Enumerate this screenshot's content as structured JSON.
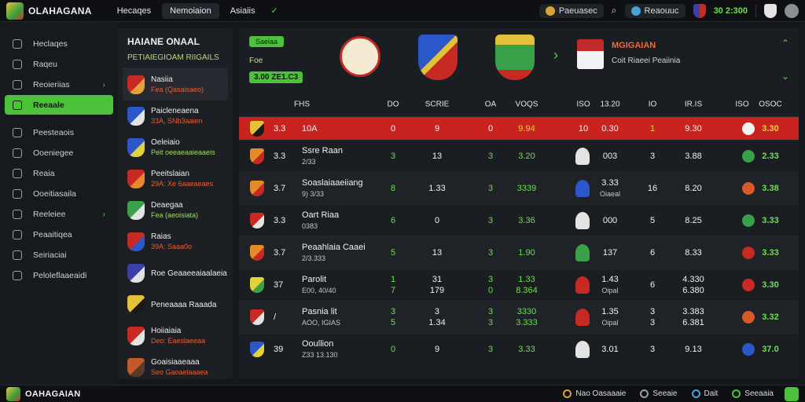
{
  "app": {
    "title": "OLAHAGANA",
    "footer_title": "OAHAGAIAN"
  },
  "nav": {
    "tabs": [
      "Hecaqes",
      "Nemoiaion",
      "Asiaiis"
    ]
  },
  "topbar": {
    "coin_label": "Paeuasec",
    "account_label": "Reaouuc",
    "score": "30 2:300"
  },
  "sidebar": {
    "items": [
      {
        "label": "Heclaqes",
        "icon": "grid-icon"
      },
      {
        "label": "Raqeu",
        "icon": "list-icon"
      },
      {
        "label": "Reoieriias",
        "icon": "square-icon",
        "arrow": "›"
      },
      {
        "label": "Reeaale",
        "icon": "star-icon",
        "active": true
      },
      {
        "label": "Peesteaois",
        "icon": "chart-icon"
      },
      {
        "label": "Ooeniegee",
        "icon": "globe-icon"
      },
      {
        "label": "Reaia",
        "icon": "clock-icon"
      },
      {
        "label": "Ooeitiasaila",
        "icon": "users-icon"
      },
      {
        "label": "Reeleiee",
        "icon": "gear-icon",
        "arrow": "›"
      },
      {
        "label": "Peaaitiqea",
        "icon": "flag-icon"
      },
      {
        "label": "Seiriaciai",
        "icon": "bell-icon"
      },
      {
        "label": "Peloleflaaeaidi",
        "icon": "help-icon"
      }
    ]
  },
  "leagues": {
    "title": "HAIANE ONAAL",
    "subtitle": "PETIAIEGIOAM RIIGAILS",
    "items": [
      {
        "name": "Nasiia",
        "meta": "Fea (Qasaisaeo)",
        "meta_color": "#e0603a",
        "c1": "#c62a22",
        "c2": "#e5a23a"
      },
      {
        "name": "Paicleneaena",
        "meta": "33A, SNb3aaien",
        "meta_color": "#e0603a",
        "c1": "#2b57c9",
        "c2": "#e3e3e3"
      },
      {
        "name": "Oeleiaio",
        "meta": "Peit oeeaeaaieaaeis",
        "meta_color": "#9fd86a",
        "c1": "#2b57c9",
        "c2": "#e3d23a"
      },
      {
        "name": "Peeitslaian",
        "meta": "29A: Xe 6aaeaeaes",
        "meta_color": "#e0603a",
        "c1": "#c62a22",
        "c2": "#e58a2a"
      },
      {
        "name": "Deaegaa",
        "meta": "Fea (aeoisiata)",
        "meta_color": "#9fd86a",
        "c1": "#3aa04a",
        "c2": "#e3e3e3"
      },
      {
        "name": "Raias",
        "meta": "39A: Saaa0o",
        "meta_color": "#e0603a",
        "c1": "#c62a22",
        "c2": "#2b57c9"
      },
      {
        "name": "Roe Geaaeeaiaalaeia",
        "meta": "",
        "meta_color": "#e0603a",
        "c1": "#3b3fa8",
        "c2": "#e3e3e3"
      },
      {
        "name": "Peneaaaa Raaada",
        "meta": "",
        "meta_color": "#e0603a",
        "c1": "#e3c23a",
        "c2": "#1a1a1a"
      },
      {
        "name": "Hoiiaiaia",
        "meta": "Deo: Eaeslaeeaa",
        "meta_color": "#e0603a",
        "c1": "#c62a22",
        "c2": "#e3e3e3"
      },
      {
        "name": "Goaisiaaeaaa",
        "meta": "Seo Gaoaelaaaea",
        "meta_color": "#e0603a",
        "c1": "#c25a2a",
        "c2": "#5a3a2a"
      }
    ]
  },
  "hero": {
    "badge": "Saeiaa",
    "odds_label": "Foe",
    "odds_value": "3.00 ZE1.C3",
    "match_title": "MGIGAIAN",
    "match_subtitle": "Coit Riaeei Peaiinia"
  },
  "table": {
    "headers": [
      "FHS",
      "DO",
      "SCRIE",
      "OA",
      "VOQS",
      "ISO",
      "13.20",
      "IO",
      "IR.IS",
      "ISO",
      "OSOC"
    ],
    "rows": [
      {
        "pos": "3.3",
        "team": "10A",
        "team_sub": "",
        "v1": "0",
        "v2": "9",
        "v3": "0",
        "v4": "9.94",
        "v5": "10",
        "v6": "0.30",
        "v7": "1",
        "v8": "9.30",
        "v9": "3.30",
        "crest": "#e3c23a",
        "crest2": "#1a1a1a",
        "dot": "#f1f1f1"
      },
      {
        "pos": "3.3",
        "team": "Ssre Raan",
        "team_sub": "2/33",
        "v1": "3",
        "v2": "13",
        "v3": "3",
        "v4": "3.20",
        "v5": "",
        "v6": "003",
        "v6_sub": "",
        "v7": "3",
        "v8": "3.88",
        "v9": "2.33",
        "crest": "#e58a2a",
        "crest2": "#c62a22",
        "dot": "#3aa04a",
        "mascot": "#e3e3e3"
      },
      {
        "pos": "3.7",
        "team": "Soaslaiaaeiiang",
        "team_sub": "9) 3/33",
        "v1": "8",
        "v2": "1.33",
        "v3": "3",
        "v4": "3339",
        "v5": "",
        "v6": "3.33",
        "v6_sub": "Oiaeal",
        "v7": "16",
        "v8": "8.20",
        "v9": "3.38",
        "crest": "#e58a2a",
        "crest2": "#c62a22",
        "dot": "#d9592a",
        "mascot": "#2b57c9"
      },
      {
        "pos": "3.3",
        "team": "Oart Riaa",
        "team_sub": "0383",
        "v1": "6",
        "v2": "0",
        "v3": "3",
        "v4": "3.36",
        "v5": "",
        "v6": "000",
        "v6_sub": "",
        "v7": "5",
        "v8": "8.25",
        "v9": "3.33",
        "crest": "#c62a22",
        "crest2": "#e3e3e3",
        "dot": "#3aa04a",
        "mascot": "#e3e3e3"
      },
      {
        "pos": "3.7",
        "team": "Peaahlaia Caaei",
        "team_sub": "2/3.333",
        "v1": "5",
        "v2": "13",
        "v3": "3",
        "v4": "1.90",
        "v5": "",
        "v6": "137",
        "v6_sub": "",
        "v7": "6",
        "v8": "8.33",
        "v9": "3.33",
        "crest": "#e58a2a",
        "crest2": "#c62a22",
        "dot": "#c62a22",
        "mascot": "#3aa04a"
      },
      {
        "pos": "37",
        "team": "Parolit",
        "team_sub": "E00, 40/40",
        "v1": "1",
        "v1b": "7",
        "v2": "31",
        "v2b": "179",
        "v3": "3",
        "v3b": "0",
        "v4": "1.33",
        "v4b": "8.364",
        "v5": "",
        "v6": "1.43",
        "v6_sub": "Oipal",
        "v7": "6",
        "v8": "4.330",
        "v8b": "6.380",
        "v9": "3.30",
        "crest": "#e3d23a",
        "crest2": "#3aa04a",
        "dot": "#c62a22",
        "mascot": "#c62a22"
      },
      {
        "pos": "/",
        "team": "Pasnia lit",
        "team_sub": "AOO, IGIAS",
        "v1": "3",
        "v1b": "5",
        "v2": "3",
        "v2b": "1.34",
        "v3": "3",
        "v3b": "3",
        "v4": "3330",
        "v4b": "3.333",
        "v5": "",
        "v6": "1.35",
        "v6_sub": "Oipal",
        "v7": "3",
        "v7b": "3",
        "v8": "3.383",
        "v8b": "6.381",
        "v9": "3.32",
        "crest": "#c62a22",
        "crest2": "#e3e3e3",
        "dot": "#d9592a",
        "mascot": "#c62a22"
      },
      {
        "pos": "39",
        "team": "Ooullion",
        "team_sub": "Z33 13.130",
        "v1": "0",
        "v2": "9",
        "v3": "3",
        "v4": "3.33",
        "v5": "",
        "v6": "3.01",
        "v6_sub": "",
        "v7": "3",
        "v8": "9.13",
        "v9": "37.0",
        "crest": "#2b57c9",
        "crest2": "#e3d23a",
        "dot": "#2b57c9",
        "mascot": "#e3e3e3"
      }
    ]
  },
  "footer": {
    "items": [
      {
        "label": "Nao Oasaaaie",
        "icon": "coin-icon"
      },
      {
        "label": "Seeaie",
        "icon": "link-icon"
      },
      {
        "label": "Dait",
        "icon": "info-icon"
      },
      {
        "label": "Seeaaia",
        "icon": "power-icon"
      }
    ]
  }
}
